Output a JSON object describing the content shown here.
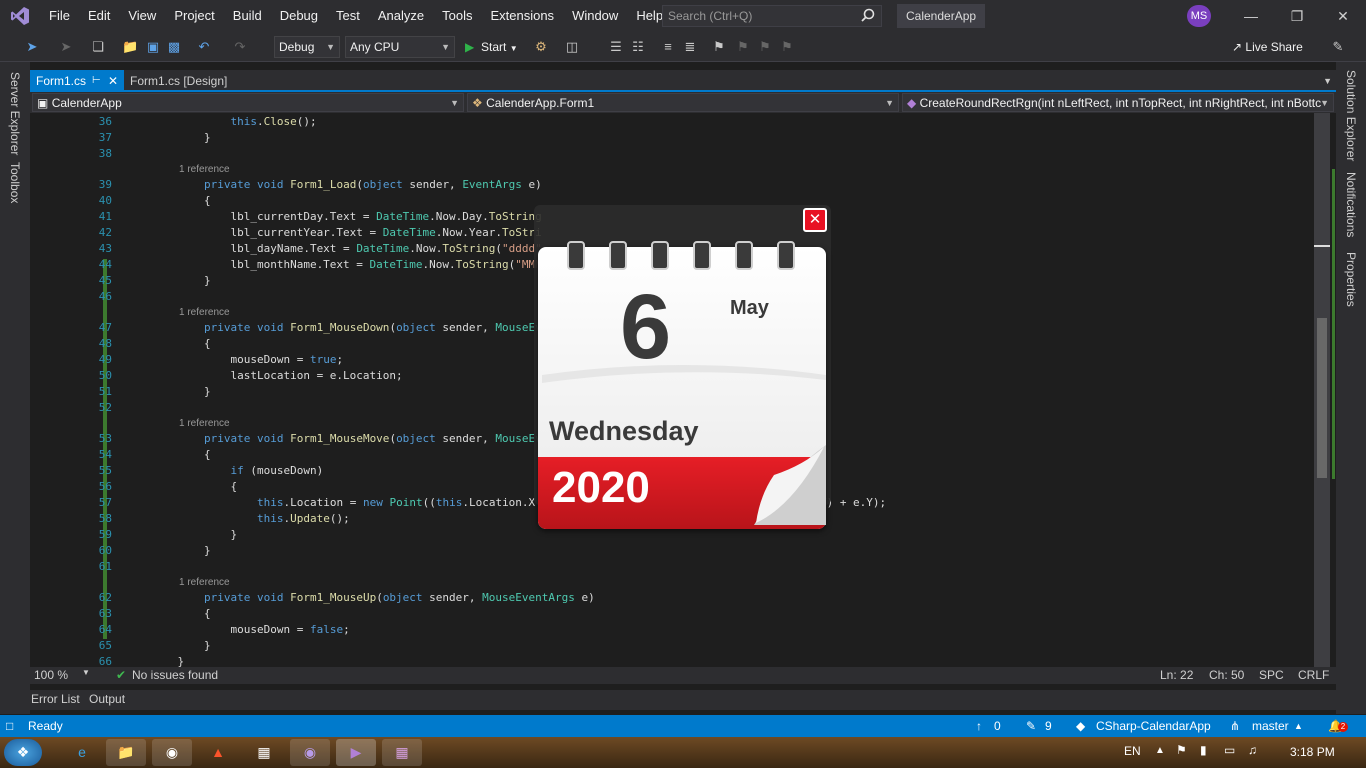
{
  "menu": {
    "items": [
      "File",
      "Edit",
      "View",
      "Project",
      "Build",
      "Debug",
      "Test",
      "Analyze",
      "Tools",
      "Extensions",
      "Window",
      "Help"
    ],
    "search_placeholder": "Search (Ctrl+Q)",
    "solution_name": "CalenderApp",
    "avatar_initials": "MS"
  },
  "toolbar": {
    "config": "Debug",
    "platform": "Any CPU",
    "start_label": "Start",
    "live_share_label": "Live Share"
  },
  "side_tabs": {
    "left": [
      "Server Explorer",
      "Toolbox"
    ],
    "right": [
      "Solution Explorer",
      "Notifications",
      "Properties"
    ]
  },
  "tabs": {
    "active": "Form1.cs",
    "other": "Form1.cs [Design]"
  },
  "navbar": {
    "project": "CalenderApp",
    "class": "CalenderApp.Form1",
    "member": "CreateRoundRectRgn(int nLeftRect, int nTopRect, int nRightRect, int nBottc"
  },
  "editor": {
    "lines": [
      {
        "n": "36",
        "t": "            this.Close();"
      },
      {
        "n": "37",
        "t": "        }"
      },
      {
        "n": "38",
        "t": ""
      },
      {
        "ref": "1 reference"
      },
      {
        "n": "39",
        "t": "        private void Form1_Load(object sender, EventArgs e)"
      },
      {
        "n": "40",
        "t": "        {"
      },
      {
        "n": "41",
        "t": "            lbl_currentDay.Text = DateTime.Now.Day.ToString"
      },
      {
        "n": "42",
        "t": "            lbl_currentYear.Text = DateTime.Now.Year.ToStri"
      },
      {
        "n": "43",
        "t": "            lbl_dayName.Text = DateTime.Now.ToString(\"dddd\""
      },
      {
        "n": "44",
        "t": "            lbl_monthName.Text = DateTime.Now.ToString(\"MMM"
      },
      {
        "n": "45",
        "t": "        }"
      },
      {
        "n": "46",
        "t": ""
      },
      {
        "ref": "1 reference"
      },
      {
        "n": "47",
        "t": "        private void Form1_MouseDown(object sender, MouseEv"
      },
      {
        "n": "48",
        "t": "        {"
      },
      {
        "n": "49",
        "t": "            mouseDown = true;"
      },
      {
        "n": "50",
        "t": "            lastLocation = e.Location;"
      },
      {
        "n": "51",
        "t": "        }"
      },
      {
        "n": "52",
        "t": ""
      },
      {
        "ref": "1 reference"
      },
      {
        "n": "53",
        "t": "        private void Form1_MouseMove(object sender, MouseEv"
      },
      {
        "n": "54",
        "t": "        {"
      },
      {
        "n": "55",
        "t": "            if (mouseDown)"
      },
      {
        "n": "56",
        "t": "            {"
      },
      {
        "n": "57",
        "t": "                this.Location = new Point((this.Location.X                            - lastLocation.Y) + e.Y);"
      },
      {
        "n": "58",
        "t": "                this.Update();"
      },
      {
        "n": "59",
        "t": "            }"
      },
      {
        "n": "60",
        "t": "        }"
      },
      {
        "n": "61",
        "t": ""
      },
      {
        "ref": "1 reference"
      },
      {
        "n": "62",
        "t": "        private void Form1_MouseUp(object sender, MouseEventArgs e)"
      },
      {
        "n": "63",
        "t": "        {"
      },
      {
        "n": "64",
        "t": "            mouseDown = false;"
      },
      {
        "n": "65",
        "t": "        }"
      },
      {
        "n": "66",
        "t": "    }"
      }
    ]
  },
  "editor_status": {
    "zoom": "100 %",
    "issues": "No issues found",
    "ln": "Ln: 22",
    "ch": "Ch: 50",
    "spc": "SPC",
    "crlf": "CRLF"
  },
  "bottom_tabs": [
    "Error List",
    "Output"
  ],
  "status": {
    "ready": "Ready",
    "up_count": "0",
    "edit_count": "9",
    "repo": "CSharp-CalendarApp",
    "branch": "master",
    "notif": "2"
  },
  "taskbar": {
    "lang": "EN",
    "time": "3:18 PM"
  },
  "calendar": {
    "day": "6",
    "month": "May",
    "weekday": "Wednesday",
    "year": "2020"
  }
}
